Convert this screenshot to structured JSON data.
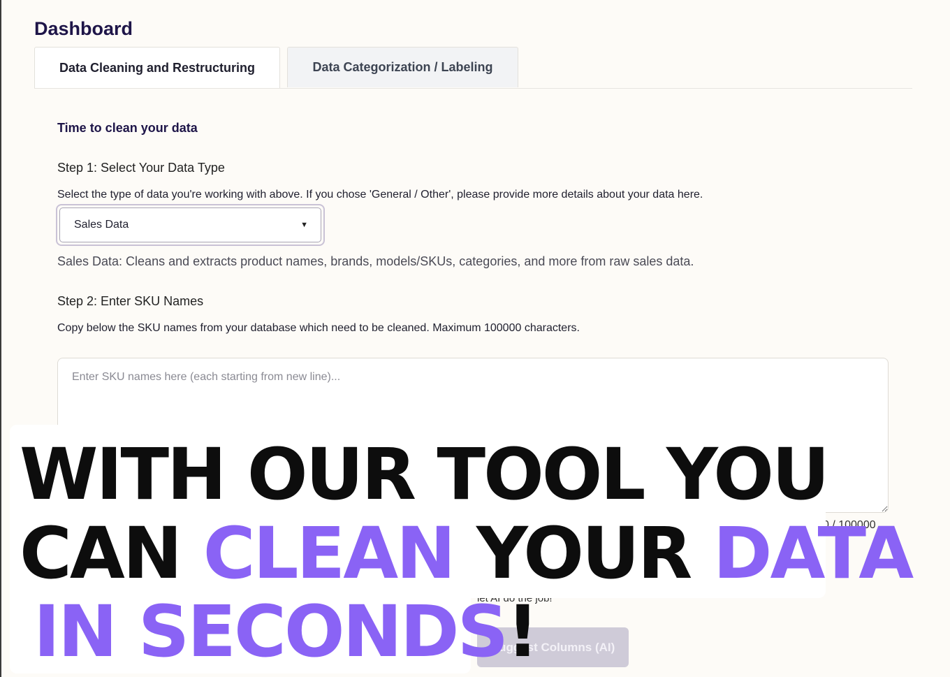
{
  "dashboard": {
    "title": "Dashboard"
  },
  "tabs": [
    {
      "label": "Data Cleaning and Restructuring",
      "active": true
    },
    {
      "label": "Data Categorization / Labeling",
      "active": false
    }
  ],
  "cleaning": {
    "section_title": "Time to clean your data",
    "step1": {
      "title": "Step 1: Select Your Data Type",
      "description": "Select the type of data you're working with above. If you chose 'General / Other', please provide more details about your data here.",
      "selected": "Sales Data",
      "type_description": "Sales Data: Cleans and extracts product names, brands, models/SKUs, categories, and more from raw sales data."
    },
    "step2": {
      "title": "Step 2: Enter SKU Names",
      "description": "Copy below the SKU names from your database which need to be cleaned. Maximum 100000 characters.",
      "placeholder": "Enter SKU names here (each starting from new line)...",
      "counter": "0 / 100000"
    },
    "partial_hint": "let AI do the job!",
    "suggest_button": "Suggest Columns (AI)"
  },
  "overlay": {
    "line1": "WITH OUR TOOL YOU",
    "line2_a": "CAN ",
    "line2_b": "CLEAN",
    "line2_c": " YOUR ",
    "line2_d": "DATA",
    "line3_a": "IN SECONDS",
    "line3_b": "!",
    "accent_color": "#8a63f5"
  }
}
